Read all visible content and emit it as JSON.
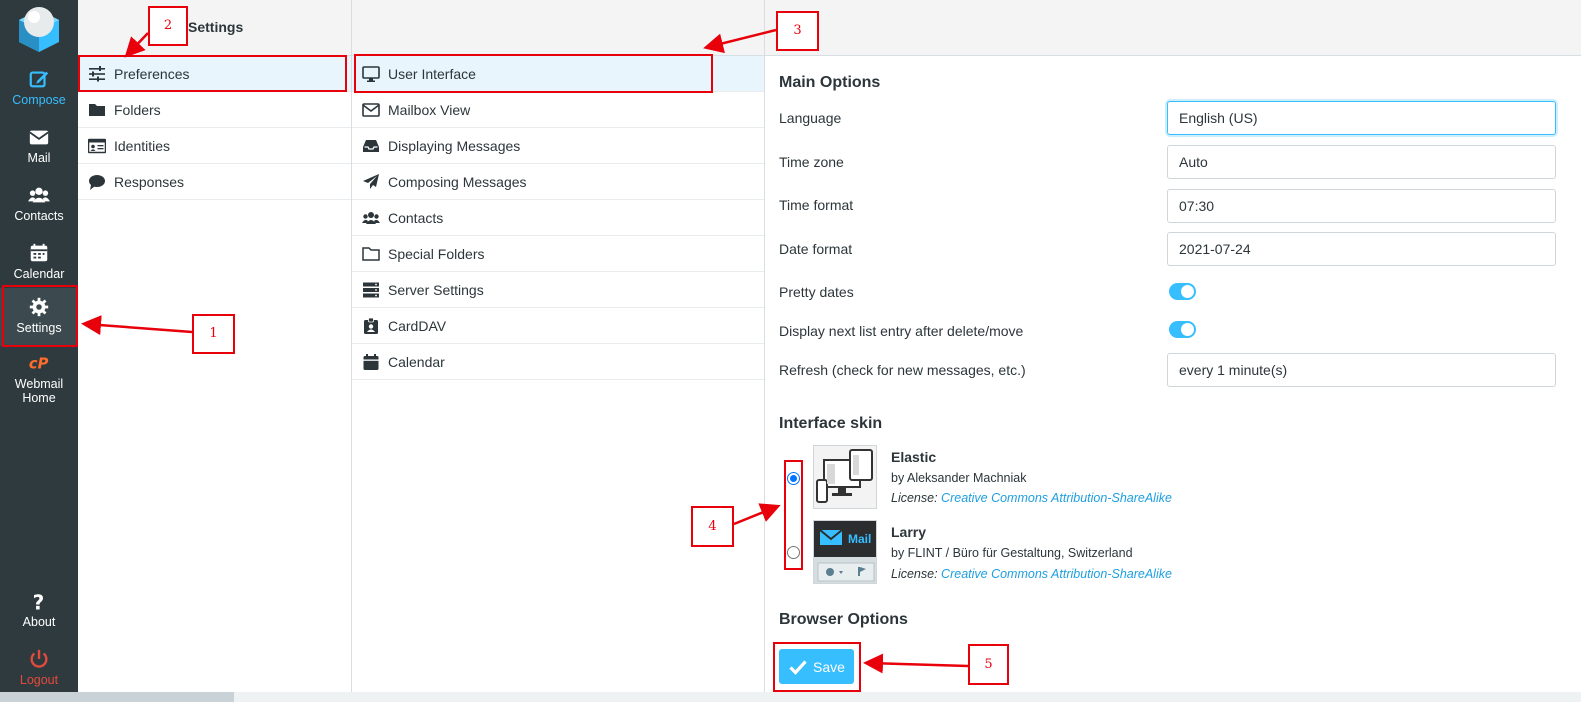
{
  "app_nav": {
    "compose": "Compose",
    "mail": "Mail",
    "contacts": "Contacts",
    "calendar": "Calendar",
    "settings": "Settings",
    "webmail_home": "Webmail Home",
    "about": "About",
    "logout": "Logout"
  },
  "settings_column": {
    "title": "Settings",
    "items": [
      "Preferences",
      "Folders",
      "Identities",
      "Responses"
    ]
  },
  "sections_column": {
    "items": [
      "User Interface",
      "Mailbox View",
      "Displaying Messages",
      "Composing Messages",
      "Contacts",
      "Special Folders",
      "Server Settings",
      "CardDAV",
      "Calendar"
    ]
  },
  "main_options": {
    "title": "Main Options",
    "language_label": "Language",
    "language_value": "English (US)",
    "timezone_label": "Time zone",
    "timezone_value": "Auto",
    "timeformat_label": "Time format",
    "timeformat_value": "07:30",
    "dateformat_label": "Date format",
    "dateformat_value": "2021-07-24",
    "prettydates_label": "Pretty dates",
    "prettydates_on": true,
    "nextentry_label": "Display next list entry after delete/move",
    "nextentry_on": true,
    "refresh_label": "Refresh (check for new messages, etc.)",
    "refresh_value": "every 1 minute(s)"
  },
  "interface_skin": {
    "title": "Interface skin",
    "skins": [
      {
        "name": "Elastic",
        "by": "by Aleksander Machniak",
        "license_label": "License:",
        "license": "Creative Commons Attribution-ShareAlike",
        "selected": true
      },
      {
        "name": "Larry",
        "by": "by FLINT / Büro für Gestaltung, Switzerland",
        "license_label": "License:",
        "license": "Creative Commons Attribution-ShareAlike",
        "selected": false
      }
    ],
    "larry_thumb_text": "Mail"
  },
  "browser_options": {
    "title": "Browser Options"
  },
  "save_label": "Save",
  "annotations": [
    "1",
    "2",
    "3",
    "4",
    "5"
  ],
  "colors": {
    "sidebar_bg": "#2f3a3f",
    "accent": "#37beff",
    "annotation": "#e8000b",
    "logout": "#e34a3b"
  }
}
